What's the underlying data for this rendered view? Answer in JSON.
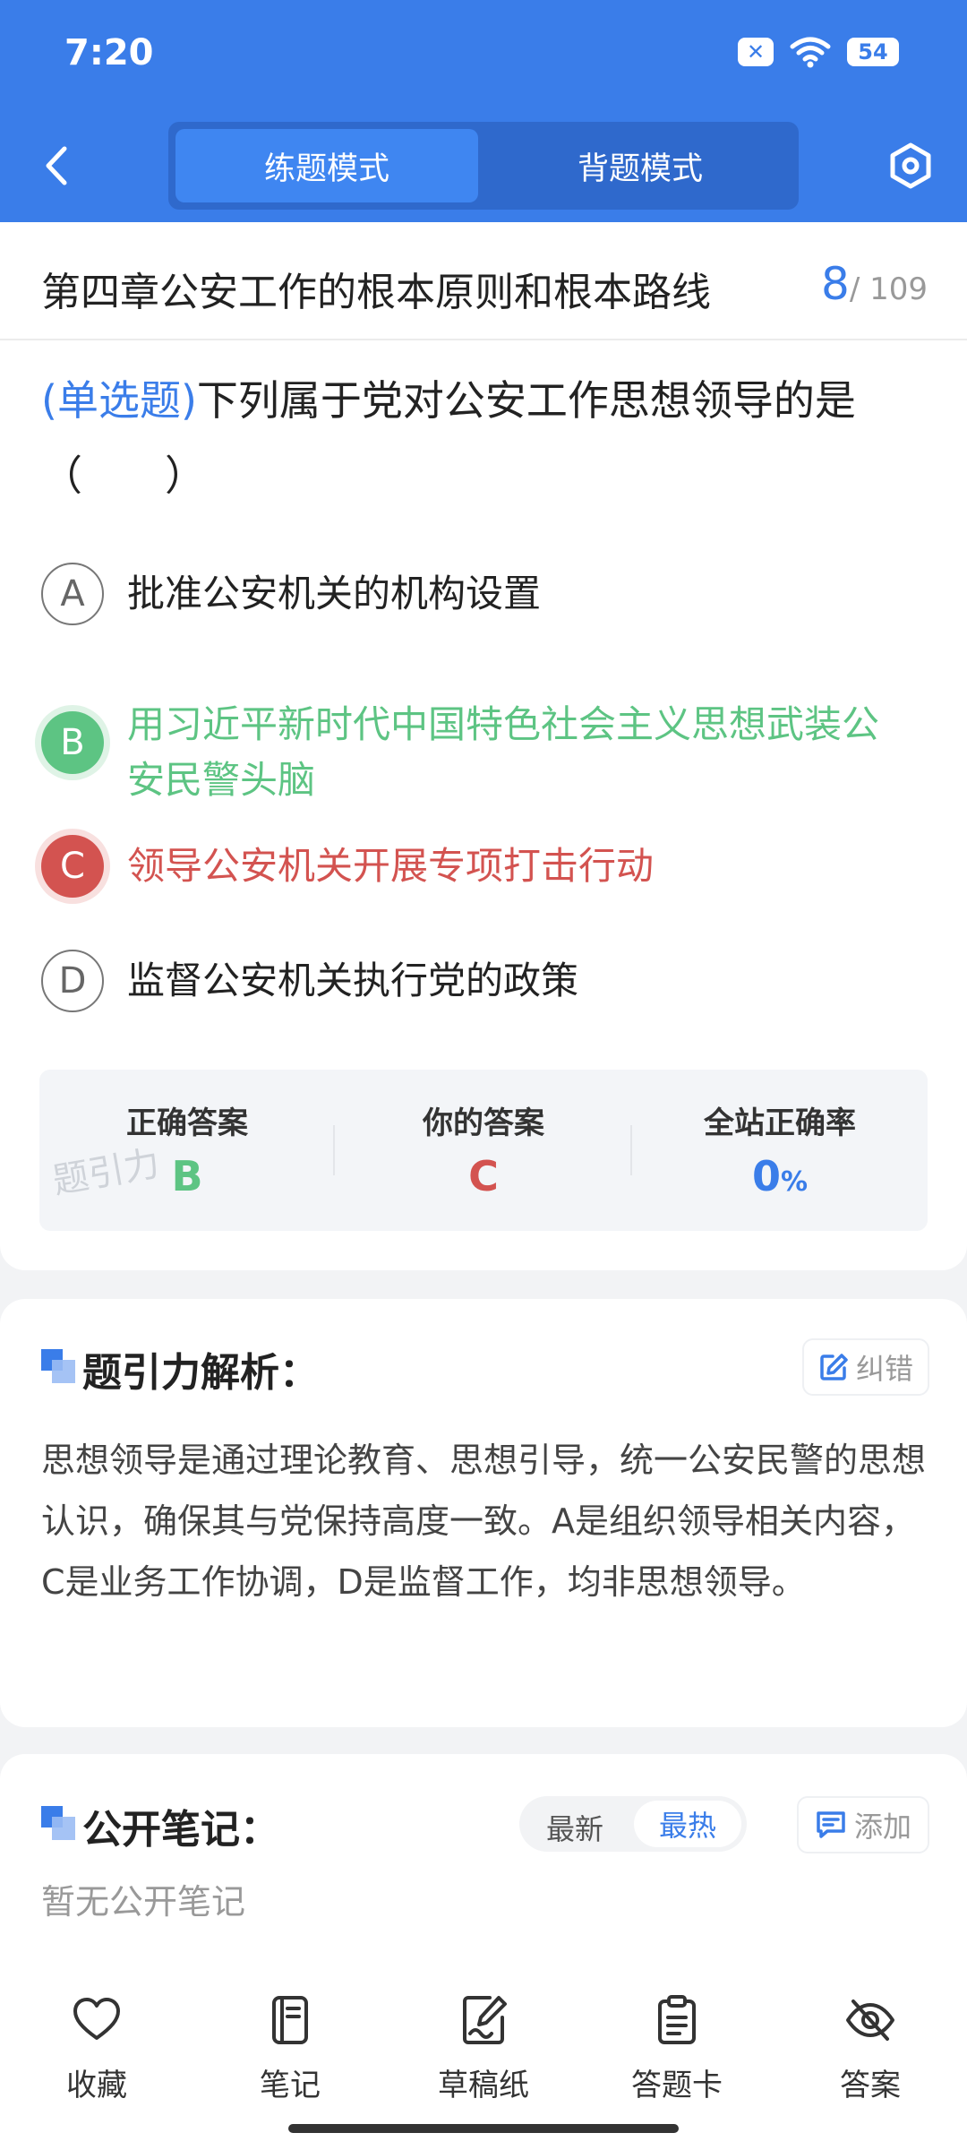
{
  "status_bar": {
    "time": "7:20",
    "battery": "54"
  },
  "header": {
    "tabs": [
      {
        "label": "练题模式",
        "active": true
      },
      {
        "label": "背题模式",
        "active": false
      }
    ]
  },
  "chapter": {
    "title": "第四章公安工作的根本原则和根本路线",
    "current": "8",
    "total": "/ 109"
  },
  "question": {
    "type_tag": "(单选题)",
    "text": "下列属于党对公安工作思想领导的是（　　）"
  },
  "options": [
    {
      "letter": "A",
      "text": "批准公安机关的机构设置",
      "state": "normal"
    },
    {
      "letter": "B",
      "text": "用习近平新时代中国特色社会主义思想武装公安民警头脑",
      "state": "correct"
    },
    {
      "letter": "C",
      "text": "领导公安机关开展专项打击行动",
      "state": "wrong"
    },
    {
      "letter": "D",
      "text": "监督公安机关执行党的政策",
      "state": "normal"
    }
  ],
  "answer_summary": {
    "correct_label": "正确答案",
    "correct_value": "B",
    "yours_label": "你的答案",
    "yours_value": "C",
    "rate_label": "全站正确率",
    "rate_value": "0",
    "rate_unit": "%",
    "watermark": "题引力"
  },
  "analysis": {
    "title": "题引力解析：",
    "correct_button": "纠错",
    "text": "思想领导是通过理论教育、思想引导，统一公安民警的思想认识，确保其与党保持高度一致。A是组织领导相关内容，C是业务工作协调，D是监督工作，均非思想领导。"
  },
  "notes": {
    "title": "公开笔记：",
    "sort_latest": "最新",
    "sort_hot": "最热",
    "add_button": "添加",
    "empty": "暂无公开笔记"
  },
  "bottom_nav": [
    {
      "label": "收藏",
      "icon": "heart-icon"
    },
    {
      "label": "笔记",
      "icon": "notebook-icon"
    },
    {
      "label": "草稿纸",
      "icon": "draft-icon"
    },
    {
      "label": "答题卡",
      "icon": "answer-card-icon"
    },
    {
      "label": "答案",
      "icon": "eye-off-icon"
    }
  ],
  "colors": {
    "primary": "#3a7de9",
    "correct": "#5dc483",
    "wrong": "#d35350"
  }
}
